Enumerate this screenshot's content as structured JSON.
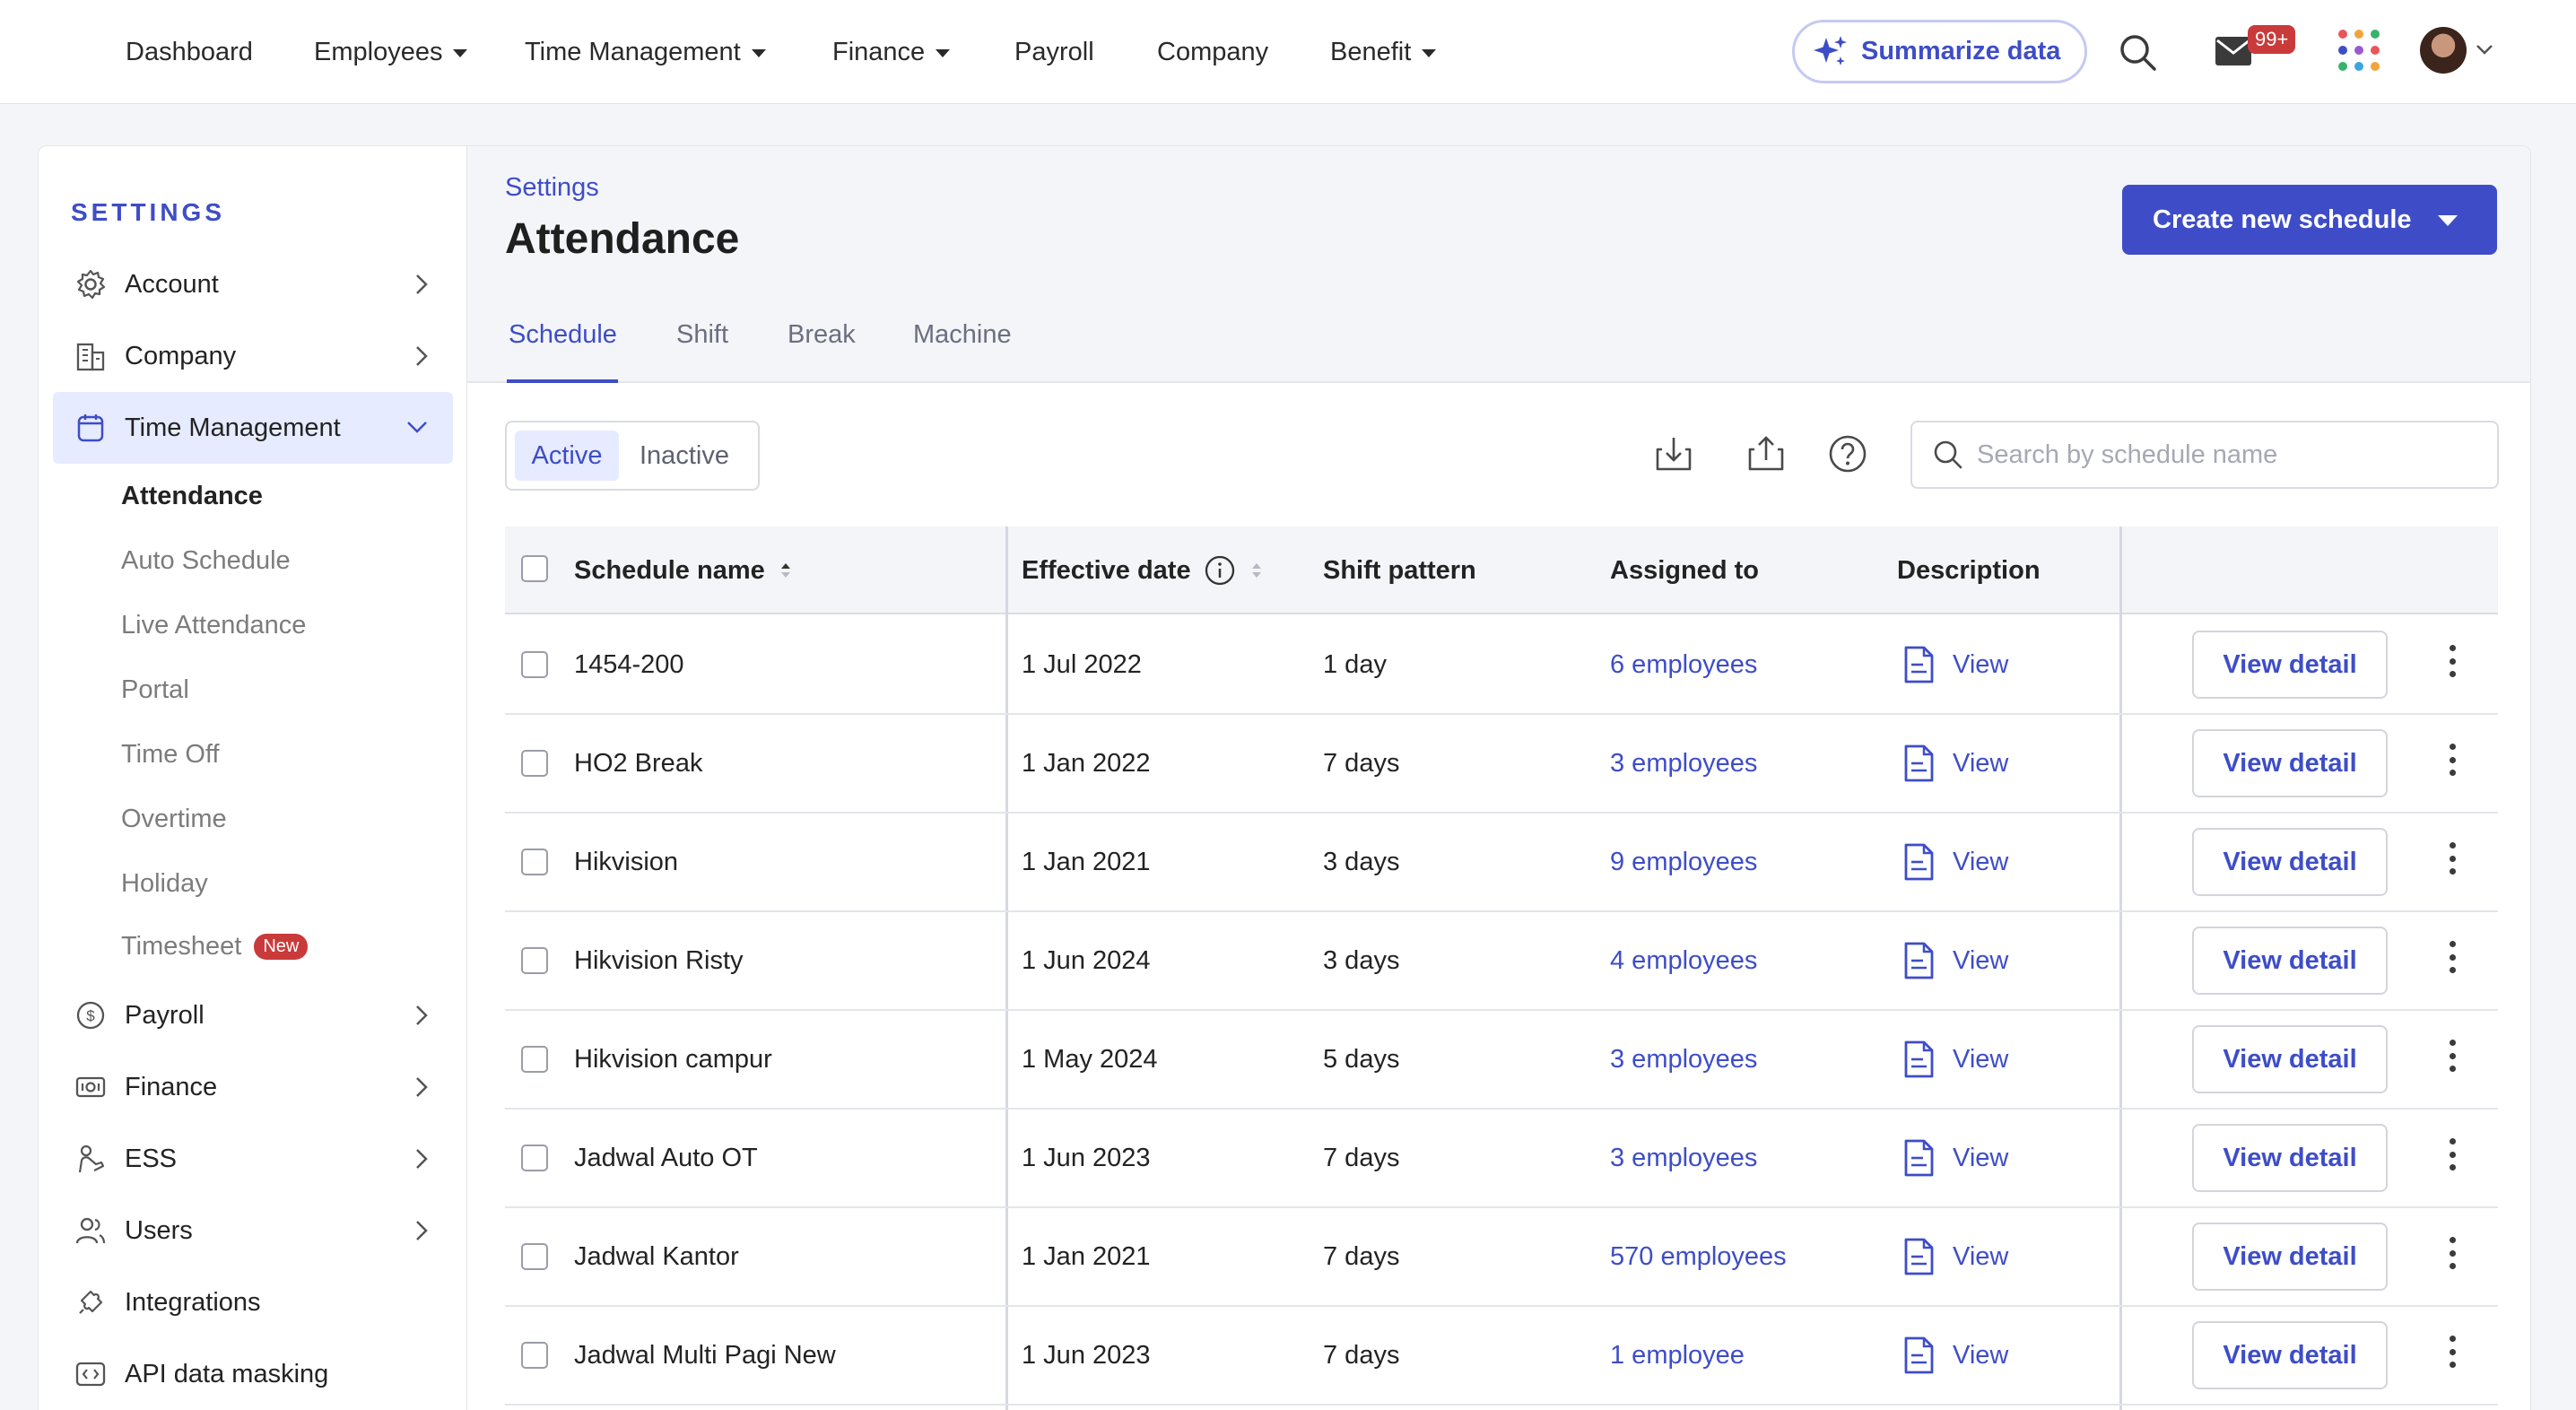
{
  "topnav": {
    "items": [
      {
        "label": "Dashboard",
        "dropdown": false
      },
      {
        "label": "Employees",
        "dropdown": true
      },
      {
        "label": "Time Management",
        "dropdown": true
      },
      {
        "label": "Finance",
        "dropdown": true
      },
      {
        "label": "Payroll",
        "dropdown": false
      },
      {
        "label": "Company",
        "dropdown": false
      },
      {
        "label": "Benefit",
        "dropdown": true
      }
    ],
    "summarize_label": "Summarize data",
    "mail_badge": "99+"
  },
  "sidebar": {
    "title": "SETTINGS",
    "items": [
      {
        "label": "Account",
        "icon": "gear-icon"
      },
      {
        "label": "Company",
        "icon": "building-icon"
      },
      {
        "label": "Time Management",
        "icon": "calendar-icon"
      },
      {
        "label": "Payroll",
        "icon": "dollar-coin-icon"
      },
      {
        "label": "Finance",
        "icon": "money-icon"
      },
      {
        "label": "ESS",
        "icon": "hand-icon"
      },
      {
        "label": "Users",
        "icon": "users-icon"
      },
      {
        "label": "Integrations",
        "icon": "puzzle-icon"
      },
      {
        "label": "API data masking",
        "icon": "code-icon"
      }
    ],
    "sub_items": [
      {
        "label": "Attendance"
      },
      {
        "label": "Auto Schedule"
      },
      {
        "label": "Live Attendance"
      },
      {
        "label": "Portal"
      },
      {
        "label": "Time Off"
      },
      {
        "label": "Overtime"
      },
      {
        "label": "Holiday"
      },
      {
        "label": "Timesheet",
        "badge": "New"
      }
    ]
  },
  "header": {
    "breadcrumb": "Settings",
    "title": "Attendance",
    "create_label": "Create new schedule"
  },
  "tabs": [
    "Schedule",
    "Shift",
    "Break",
    "Machine"
  ],
  "filter": {
    "active_label": "Active",
    "inactive_label": "Inactive"
  },
  "search": {
    "placeholder": "Search by schedule name"
  },
  "table": {
    "columns": [
      "Schedule name",
      "Effective date",
      "Shift pattern",
      "Assigned to",
      "Description"
    ],
    "view_label": "View",
    "detail_label": "View detail",
    "rows": [
      {
        "name": "1454-200",
        "date": "1 Jul 2022",
        "pattern": "1 day",
        "assigned": "6 employees"
      },
      {
        "name": "HO2 Break",
        "date": "1 Jan 2022",
        "pattern": "7 days",
        "assigned": "3 employees"
      },
      {
        "name": "Hikvision",
        "date": "1 Jan 2021",
        "pattern": "3 days",
        "assigned": "9 employees"
      },
      {
        "name": "Hikvision Risty",
        "date": "1 Jun 2024",
        "pattern": "3 days",
        "assigned": "4 employees"
      },
      {
        "name": "Hikvision campur",
        "date": "1 May 2024",
        "pattern": "5 days",
        "assigned": "3 employees"
      },
      {
        "name": "Jadwal Auto OT",
        "date": "1 Jun 2023",
        "pattern": "7 days",
        "assigned": "3 employees"
      },
      {
        "name": "Jadwal Kantor",
        "date": "1 Jan 2021",
        "pattern": "7 days",
        "assigned": "570 employees"
      },
      {
        "name": "Jadwal Multi Pagi New",
        "date": "1 Jun 2023",
        "pattern": "7 days",
        "assigned": "1 employee"
      }
    ]
  }
}
